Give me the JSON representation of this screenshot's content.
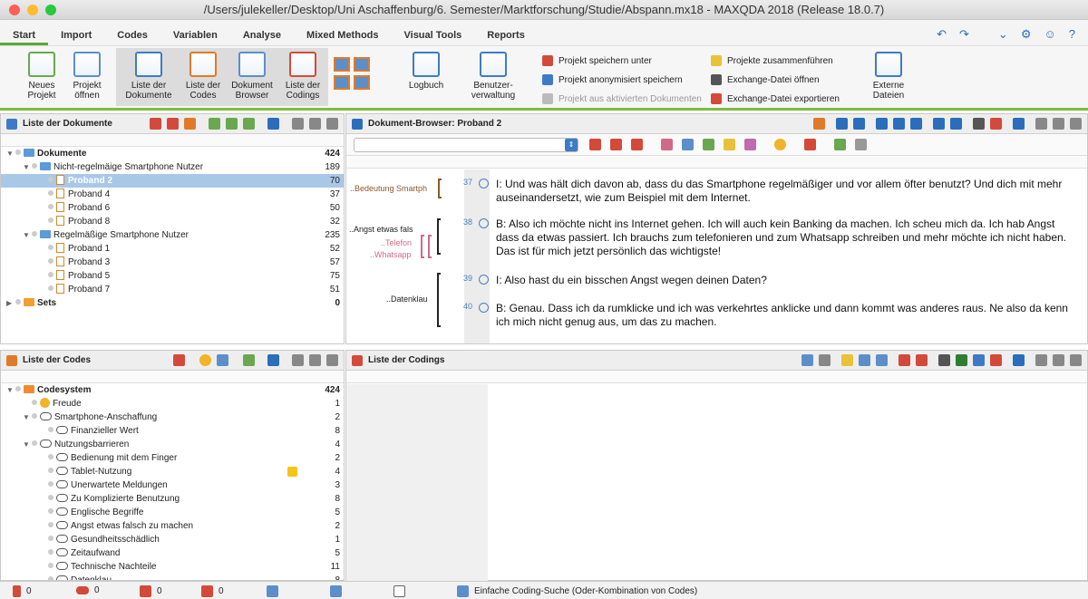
{
  "window": {
    "title": "/Users/julekeller/Desktop/Uni Aschaffenburg/6. Semester/Marktforschung/Studie/Abspann.mx18 - MAXQDA 2018  (Release 18.0.7)"
  },
  "menu": {
    "tabs": [
      "Start",
      "Import",
      "Codes",
      "Variablen",
      "Analyse",
      "Mixed Methods",
      "Visual Tools",
      "Reports"
    ],
    "active": "Start"
  },
  "ribbon": {
    "big": [
      {
        "label1": "Neues",
        "label2": "Projekt"
      },
      {
        "label1": "Projekt",
        "label2": "öffnen"
      },
      {
        "label1": "Liste der",
        "label2": "Dokumente"
      },
      {
        "label1": "Liste der",
        "label2": "Codes"
      },
      {
        "label1": "Dokument",
        "label2": "Browser"
      },
      {
        "label1": "Liste der",
        "label2": "Codings"
      },
      {
        "label1": "Logbuch",
        "label2": ""
      },
      {
        "label1": "Benutzer-",
        "label2": "verwaltung"
      },
      {
        "label1": "Externe",
        "label2": "Dateien"
      }
    ],
    "small": [
      "Projekt speichern unter",
      "Projekt anonymisiert speichern",
      "Projekt aus aktivierten Dokumenten",
      "Projekte zusammenführen",
      "Exchange-Datei öffnen",
      "Exchange-Datei exportieren"
    ]
  },
  "docs": {
    "title": "Liste der Dokumente",
    "rows": [
      {
        "label": "Dokumente",
        "count": "424",
        "level": 0,
        "type": "folder",
        "bold": true
      },
      {
        "label": "Nicht-regelmäige Smartphone Nutzer",
        "count": "189",
        "level": 1,
        "type": "folder"
      },
      {
        "label": "Proband 2",
        "count": "70",
        "level": 2,
        "type": "doc",
        "selected": true
      },
      {
        "label": "Proband 4",
        "count": "37",
        "level": 2,
        "type": "doc"
      },
      {
        "label": "Proband 6",
        "count": "50",
        "level": 2,
        "type": "doc"
      },
      {
        "label": "Proband 8",
        "count": "32",
        "level": 2,
        "type": "doc"
      },
      {
        "label": "Regelmäßige Smartphone Nutzer",
        "count": "235",
        "level": 1,
        "type": "folder"
      },
      {
        "label": "Proband 1",
        "count": "52",
        "level": 2,
        "type": "doc"
      },
      {
        "label": "Proband 3",
        "count": "57",
        "level": 2,
        "type": "doc"
      },
      {
        "label": "Proband 5",
        "count": "75",
        "level": 2,
        "type": "doc"
      },
      {
        "label": "Proband 7",
        "count": "51",
        "level": 2,
        "type": "doc"
      },
      {
        "label": "Sets",
        "count": "0",
        "level": 0,
        "type": "folder",
        "bold": true
      }
    ]
  },
  "browser": {
    "title": "Dokument-Browser: Proband 2",
    "margin_codes": [
      "..Bedeutung Smartph",
      "..Angst etwas fals",
      "..Telefon",
      "..Whatsapp",
      "..Datenklau"
    ],
    "paragraphs": [
      {
        "num": "37",
        "text": "I: Und was hält dich davon ab, dass du das Smartphone regelmäßiger und vor allem öfter benutzt? Und dich mit mehr auseinandersetzt, wie zum Beispiel mit dem Internet."
      },
      {
        "num": "38",
        "text": "B: Also ich möchte nicht ins Internet gehen. Ich will auch kein Banking da machen. Ich scheu mich da. Ich hab Angst dass da etwas passiert. Ich brauchs zum telefonieren und zum Whatsapp schreiben und mehr möchte ich nicht haben. Das ist für mich jetzt persönlich das wichtigste!"
      },
      {
        "num": "39",
        "text": "I: Also hast du ein bisschen Angst wegen deinen Daten?"
      },
      {
        "num": "40",
        "text": "B: Genau. Dass ich da rumklicke und ich was verkehrtes anklicke und dann kommt was anderes raus. Ne also da kenn ich mich nicht genug aus, um das zu machen."
      }
    ]
  },
  "codes": {
    "title": "Liste der Codes",
    "rows": [
      {
        "label": "Codesystem",
        "count": "424",
        "level": 0,
        "bold": true,
        "type": "sys"
      },
      {
        "label": "Freude",
        "count": "1",
        "level": 1,
        "type": "smile"
      },
      {
        "label": "Smartphone-Anschaffung",
        "count": "2",
        "level": 1,
        "type": "code",
        "open": true
      },
      {
        "label": "Finanzieller Wert",
        "count": "8",
        "level": 2,
        "type": "code"
      },
      {
        "label": "Nutzungsbarrieren",
        "count": "4",
        "level": 1,
        "type": "code",
        "open": true
      },
      {
        "label": "Bedienung mit dem Finger",
        "count": "2",
        "level": 2,
        "type": "code"
      },
      {
        "label": "Tablet-Nutzung",
        "count": "4",
        "level": 2,
        "type": "code",
        "memo": true
      },
      {
        "label": "Unerwartete Meldungen",
        "count": "3",
        "level": 2,
        "type": "code"
      },
      {
        "label": "Zu Komplizierte Benutzung",
        "count": "8",
        "level": 2,
        "type": "code"
      },
      {
        "label": "Englische Begriffe",
        "count": "5",
        "level": 2,
        "type": "code"
      },
      {
        "label": "Angst etwas falsch zu machen",
        "count": "2",
        "level": 2,
        "type": "code"
      },
      {
        "label": "Gesundheitsschädlich",
        "count": "1",
        "level": 2,
        "type": "code"
      },
      {
        "label": "Zeitaufwand",
        "count": "5",
        "level": 2,
        "type": "code"
      },
      {
        "label": "Technische Nachteile",
        "count": "11",
        "level": 2,
        "type": "code"
      },
      {
        "label": "Datenklau",
        "count": "8",
        "level": 2,
        "type": "code"
      }
    ]
  },
  "codings": {
    "title": "Liste der Codings"
  },
  "status": {
    "docs": "0",
    "codes": "0",
    "codings": "0",
    "memos": "0",
    "search": "Einfache Coding-Suche (Oder-Kombination von Codes)"
  },
  "colors": {
    "accent": "#7dbb3e",
    "select": "#a9c8e8",
    "link": "#4a7fc0"
  }
}
